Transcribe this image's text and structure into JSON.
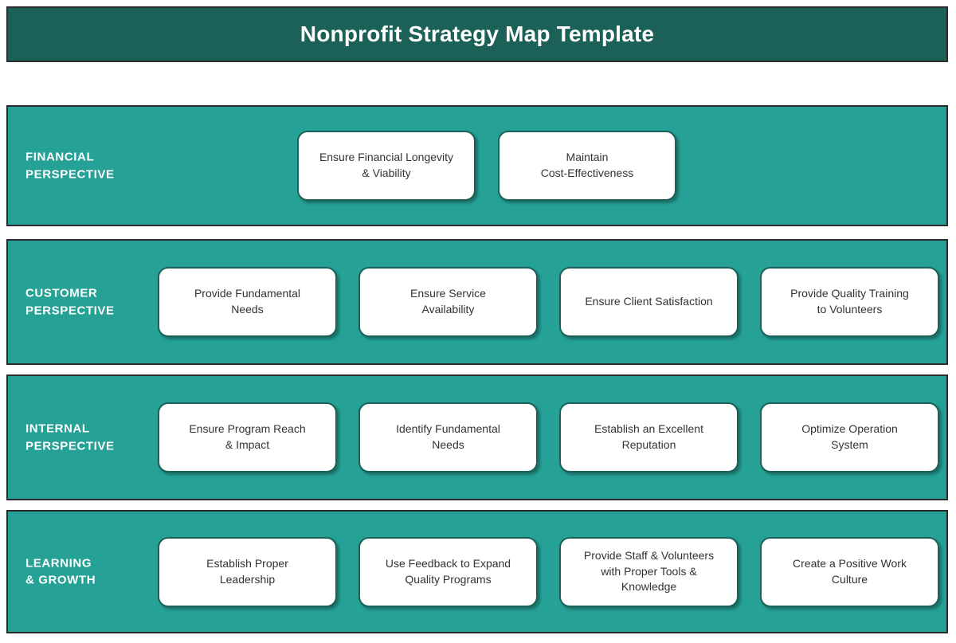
{
  "title": {
    "text": "Nonprofit Strategy Map Template"
  },
  "colors": {
    "title_bar": "#1b6158",
    "band": "#25a196",
    "band_border": "#2b2b2b",
    "card_border": "#1b6158",
    "card_fill": "#ffffff",
    "label_text": "#ffffff",
    "card_text": "#333333"
  },
  "rows": [
    {
      "id": "financial",
      "label": "FINANCIAL\nPERSPECTIVE",
      "cards": [
        {
          "text": "Ensure Financial Longevity\n& Viability"
        },
        {
          "text": "Maintain\nCost-Effectiveness"
        }
      ]
    },
    {
      "id": "customer",
      "label": "CUSTOMER\nPERSPECTIVE",
      "cards": [
        {
          "text": "Provide Fundamental\nNeeds"
        },
        {
          "text": "Ensure Service\nAvailability"
        },
        {
          "text": "Ensure Client Satisfaction"
        },
        {
          "text": "Provide Quality Training\nto Volunteers"
        }
      ]
    },
    {
      "id": "internal",
      "label": "INTERNAL\nPERSPECTIVE",
      "cards": [
        {
          "text": "Ensure Program Reach\n& Impact"
        },
        {
          "text": "Identify Fundamental\nNeeds"
        },
        {
          "text": "Establish an Excellent\nReputation"
        },
        {
          "text": "Optimize Operation\nSystem"
        }
      ]
    },
    {
      "id": "learning",
      "label": "LEARNING\n& GROWTH",
      "cards": [
        {
          "text": "Establish Proper\nLeadership"
        },
        {
          "text": "Use Feedback to Expand\nQuality Programs"
        },
        {
          "text": "Provide Staff & Volunteers\nwith Proper Tools &\nKnowledge"
        },
        {
          "text": "Create a Positive Work\nCulture"
        }
      ]
    }
  ]
}
